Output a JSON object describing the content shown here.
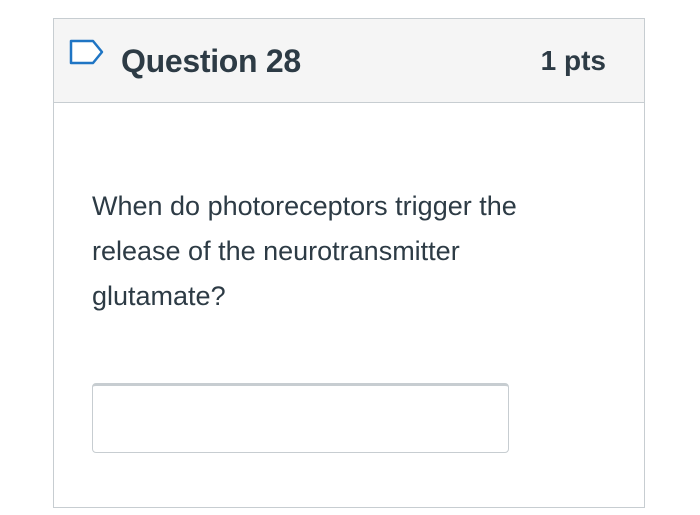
{
  "question": {
    "title": "Question 28",
    "points": "1 pts",
    "text": "When do photoreceptors trigger the release of the neurotransmitter glutamate?",
    "flag_icon": "flag-icon",
    "answer": {
      "value": "",
      "placeholder": ""
    }
  },
  "colors": {
    "border": "#c7cdd1",
    "header_bg": "#f5f5f5",
    "text": "#2d3b45",
    "flag_icon": "#1f75c4"
  }
}
